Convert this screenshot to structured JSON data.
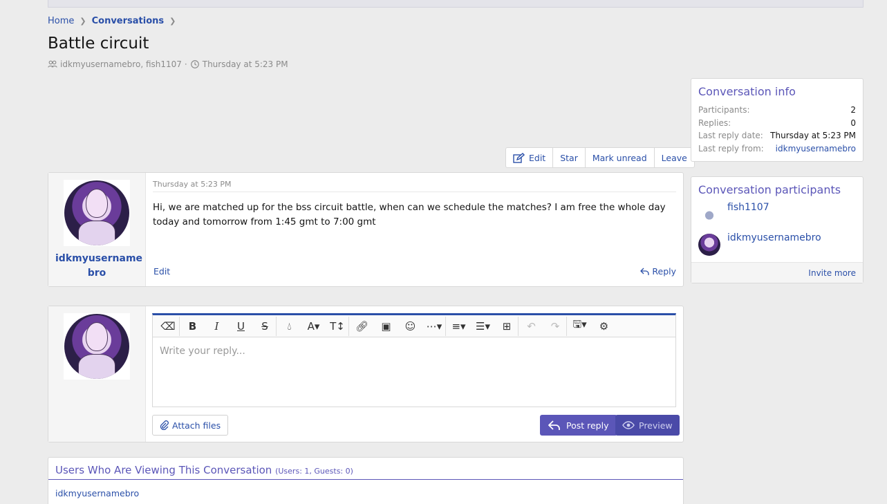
{
  "breadcrumb": {
    "home": "Home",
    "current": "Conversations"
  },
  "page": {
    "title": "Battle circuit",
    "participants": "idkmyusernamebro, fish1107",
    "sep": "·",
    "date": "Thursday at 5:23 PM"
  },
  "actions": {
    "edit": "Edit",
    "star": "Star",
    "mark_unread": "Mark unread",
    "leave": "Leave"
  },
  "message": {
    "date": "Thursday at 5:23 PM",
    "username_line1": "idkmyusername",
    "username_line2": "bro",
    "body": "Hi, we are matched up for the bss circuit battle, when can we schedule the matches? I am free the whole day today and tomorrow from 1:45 gmt to 7:00 gmt",
    "edit": "Edit",
    "reply": "Reply"
  },
  "reply_box": {
    "placeholder": "Write your reply...",
    "attach": "Attach files",
    "post": "Post reply",
    "preview": "Preview"
  },
  "viewing": {
    "title": "Users Who Are Viewing This Conversation",
    "counts": "(Users: 1, Guests: 0)",
    "user": "idkmyusernamebro"
  },
  "info": {
    "title": "Conversation info",
    "rows": [
      {
        "k": "Participants:",
        "v": "2"
      },
      {
        "k": "Replies:",
        "v": "0"
      },
      {
        "k": "Last reply date:",
        "v": "Thursday at 5:23 PM"
      },
      {
        "k": "Last reply from:",
        "v": "idkmyusernamebro"
      }
    ]
  },
  "participants": {
    "title": "Conversation participants",
    "list": [
      "fish1107",
      "idkmyusernamebro"
    ],
    "invite": "Invite more"
  },
  "colors": {
    "accent": "#5b56b8",
    "link": "#2a4fa8"
  }
}
